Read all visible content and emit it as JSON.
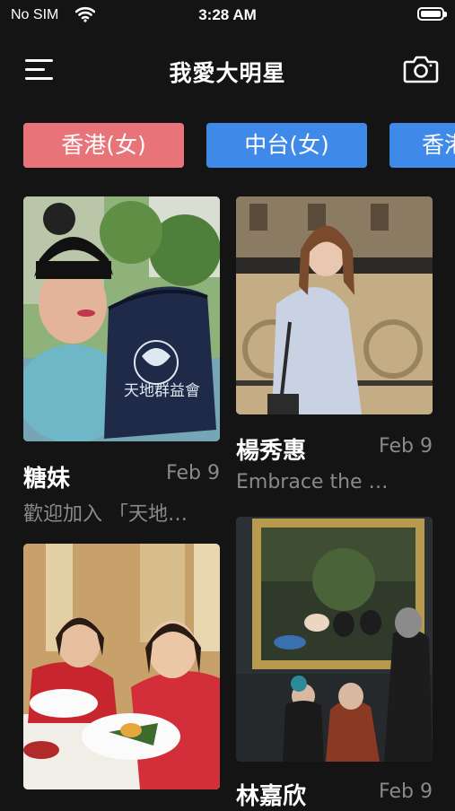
{
  "status_bar": {
    "carrier": "No SIM",
    "time": "3:28 AM",
    "battery_level": 1.0
  },
  "nav": {
    "title": "我愛大明星",
    "menu_icon": "hamburger-menu-icon",
    "camera_icon": "camera-icon"
  },
  "chips": [
    {
      "label": "香港(女)",
      "color": "#e8747a"
    },
    {
      "label": "中台(女)",
      "color": "#3f8ae8"
    },
    {
      "label": "香港",
      "color": "#3f8ae8"
    }
  ],
  "cards": [
    {
      "name": "糖妹",
      "date": "Feb 9",
      "desc": "歡迎加入 「天地…",
      "bag_text": "天地群益會"
    },
    {
      "name": "楊秀惠",
      "date": "Feb 9",
      "desc": "Embrace the …"
    },
    {
      "name": "",
      "date": "",
      "desc": ""
    },
    {
      "name": "林嘉欣",
      "date": "Feb 9",
      "desc": ""
    }
  ]
}
